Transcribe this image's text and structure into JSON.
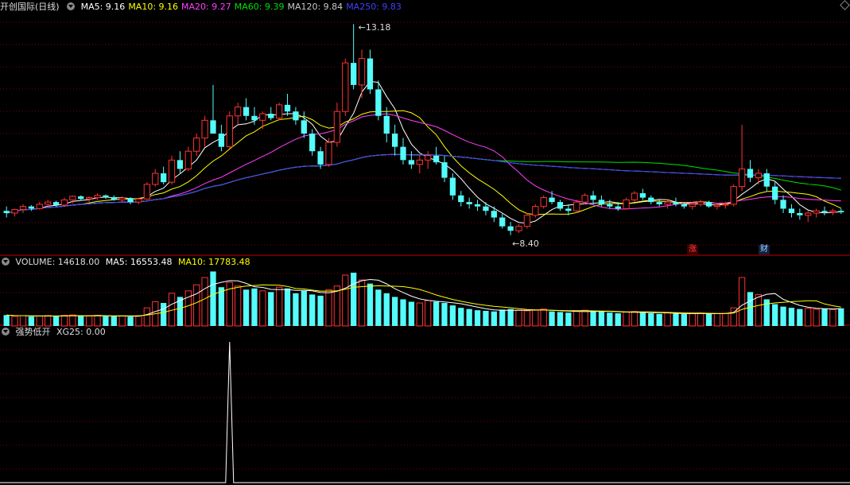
{
  "header": {
    "name": "开创国际(日线)",
    "ma": [
      {
        "label": "MA5: 9.16",
        "color": "#ffffff"
      },
      {
        "label": "MA10: 9.16",
        "color": "#ffff00"
      },
      {
        "label": "MA20: 9.27",
        "color": "#ff40ff"
      },
      {
        "label": "MA60: 9.39",
        "color": "#00e000"
      },
      {
        "label": "MA120: 9.84",
        "color": "#c8c8c8"
      },
      {
        "label": "MA250: 9.83",
        "color": "#4040ff"
      }
    ]
  },
  "volume_header": {
    "label": "VOLUME: 14618.00",
    "ma5": "MA5: 16553.48",
    "ma10": "MA10: 17783.48"
  },
  "indicator_header": {
    "name": "强势低开",
    "value": "XG25: 0.00"
  },
  "annotations": {
    "high": "13.18",
    "low": "8.40",
    "badge1": "涨",
    "badge2": "财"
  },
  "colors": {
    "up": "#ff3232",
    "down": "#54fcfc",
    "grid": "#800000",
    "axis": "#c00000"
  },
  "chart_data": {
    "type": "candlestick",
    "price_range": [
      8.0,
      13.4
    ],
    "candles": [
      [
        8.95,
        9.05,
        8.8,
        8.9
      ],
      [
        8.9,
        9.0,
        8.82,
        8.98
      ],
      [
        8.98,
        9.1,
        8.9,
        9.05
      ],
      [
        9.05,
        9.08,
        8.95,
        9.0
      ],
      [
        9.0,
        9.15,
        8.98,
        9.1
      ],
      [
        9.1,
        9.2,
        9.02,
        9.15
      ],
      [
        9.15,
        9.18,
        9.05,
        9.08
      ],
      [
        9.08,
        9.25,
        9.05,
        9.2
      ],
      [
        9.2,
        9.3,
        9.12,
        9.28
      ],
      [
        9.28,
        9.3,
        9.18,
        9.22
      ],
      [
        9.22,
        9.28,
        9.15,
        9.25
      ],
      [
        9.25,
        9.35,
        9.2,
        9.3
      ],
      [
        9.3,
        9.32,
        9.22,
        9.26
      ],
      [
        9.26,
        9.3,
        9.18,
        9.2
      ],
      [
        9.2,
        9.28,
        9.15,
        9.24
      ],
      [
        9.24,
        9.26,
        9.1,
        9.15
      ],
      [
        9.15,
        9.25,
        9.1,
        9.22
      ],
      [
        9.22,
        9.6,
        9.2,
        9.55
      ],
      [
        9.55,
        9.9,
        9.5,
        9.8
      ],
      [
        9.8,
        9.95,
        9.55,
        9.6
      ],
      [
        9.6,
        10.2,
        9.55,
        10.1
      ],
      [
        10.1,
        10.3,
        9.8,
        9.9
      ],
      [
        9.9,
        10.4,
        9.85,
        10.3
      ],
      [
        10.3,
        10.7,
        10.2,
        10.6
      ],
      [
        10.6,
        11.1,
        10.4,
        11.0
      ],
      [
        11.0,
        11.8,
        10.8,
        10.7
      ],
      [
        10.7,
        10.9,
        10.3,
        10.4
      ],
      [
        10.4,
        11.2,
        10.35,
        11.1
      ],
      [
        11.1,
        11.4,
        10.9,
        11.3
      ],
      [
        11.3,
        11.5,
        11.0,
        11.1
      ],
      [
        11.1,
        11.3,
        10.9,
        11.0
      ],
      [
        11.0,
        11.2,
        10.8,
        11.15
      ],
      [
        11.15,
        11.3,
        11.0,
        11.05
      ],
      [
        11.05,
        11.4,
        11.0,
        11.35
      ],
      [
        11.35,
        11.6,
        11.1,
        11.2
      ],
      [
        11.2,
        11.3,
        10.9,
        11.0
      ],
      [
        11.0,
        11.2,
        10.6,
        10.7
      ],
      [
        10.7,
        10.8,
        10.2,
        10.3
      ],
      [
        10.3,
        10.4,
        9.9,
        10.0
      ],
      [
        10.0,
        10.6,
        9.95,
        10.5
      ],
      [
        10.5,
        11.4,
        10.4,
        11.2
      ],
      [
        11.2,
        12.4,
        11.1,
        12.3
      ],
      [
        12.3,
        13.18,
        11.7,
        11.8
      ],
      [
        11.8,
        12.6,
        11.5,
        12.4
      ],
      [
        12.4,
        12.6,
        11.6,
        11.7
      ],
      [
        11.7,
        11.9,
        11.0,
        11.1
      ],
      [
        11.1,
        11.3,
        10.5,
        10.7
      ],
      [
        10.7,
        10.9,
        10.2,
        10.4
      ],
      [
        10.4,
        10.6,
        10.0,
        10.1
      ],
      [
        10.1,
        10.3,
        9.9,
        10.0
      ],
      [
        10.0,
        10.2,
        9.8,
        10.1
      ],
      [
        10.1,
        10.3,
        9.9,
        10.2
      ],
      [
        10.2,
        10.4,
        10.0,
        10.05
      ],
      [
        10.05,
        10.2,
        9.6,
        9.7
      ],
      [
        9.7,
        9.8,
        9.2,
        9.3
      ],
      [
        9.3,
        9.4,
        9.05,
        9.15
      ],
      [
        9.15,
        9.25,
        9.0,
        9.1
      ],
      [
        9.1,
        9.2,
        8.95,
        9.05
      ],
      [
        9.05,
        9.15,
        8.85,
        8.95
      ],
      [
        8.95,
        9.05,
        8.7,
        8.8
      ],
      [
        8.8,
        8.9,
        8.55,
        8.6
      ],
      [
        8.6,
        8.7,
        8.4,
        8.5
      ],
      [
        8.5,
        8.65,
        8.45,
        8.6
      ],
      [
        8.6,
        8.9,
        8.55,
        8.85
      ],
      [
        8.85,
        9.1,
        8.8,
        9.05
      ],
      [
        9.05,
        9.3,
        9.0,
        9.25
      ],
      [
        9.25,
        9.4,
        9.1,
        9.15
      ],
      [
        9.15,
        9.2,
        8.95,
        9.0
      ],
      [
        9.0,
        9.1,
        8.85,
        8.95
      ],
      [
        8.95,
        9.2,
        8.9,
        9.15
      ],
      [
        9.15,
        9.35,
        9.1,
        9.3
      ],
      [
        9.3,
        9.4,
        9.1,
        9.2
      ],
      [
        9.2,
        9.3,
        9.05,
        9.1
      ],
      [
        9.1,
        9.2,
        9.0,
        9.05
      ],
      [
        9.05,
        9.15,
        8.95,
        9.0
      ],
      [
        9.0,
        9.25,
        8.98,
        9.2
      ],
      [
        9.2,
        9.4,
        9.15,
        9.35
      ],
      [
        9.35,
        9.45,
        9.2,
        9.25
      ],
      [
        9.25,
        9.3,
        9.1,
        9.15
      ],
      [
        9.15,
        9.2,
        9.05,
        9.1
      ],
      [
        9.1,
        9.2,
        9.0,
        9.15
      ],
      [
        9.15,
        9.25,
        9.05,
        9.1
      ],
      [
        9.1,
        9.15,
        9.0,
        9.05
      ],
      [
        9.05,
        9.15,
        8.98,
        9.1
      ],
      [
        9.1,
        9.2,
        9.05,
        9.15
      ],
      [
        9.15,
        9.18,
        9.02,
        9.05
      ],
      [
        9.05,
        9.12,
        8.98,
        9.08
      ],
      [
        9.08,
        9.15,
        9.0,
        9.1
      ],
      [
        9.1,
        9.55,
        9.05,
        9.5
      ],
      [
        9.5,
        10.9,
        9.4,
        9.9
      ],
      [
        9.9,
        10.1,
        9.6,
        9.7
      ],
      [
        9.7,
        9.9,
        9.55,
        9.8
      ],
      [
        9.8,
        9.9,
        9.4,
        9.5
      ],
      [
        9.5,
        9.6,
        9.1,
        9.2
      ],
      [
        9.2,
        9.3,
        8.9,
        9.0
      ],
      [
        9.0,
        9.1,
        8.8,
        8.9
      ],
      [
        8.9,
        9.0,
        8.75,
        8.85
      ],
      [
        8.85,
        8.95,
        8.7,
        8.9
      ],
      [
        8.9,
        9.0,
        8.8,
        8.95
      ],
      [
        8.95,
        9.05,
        8.85,
        8.92
      ],
      [
        8.92,
        9.0,
        8.85,
        8.95
      ],
      [
        8.95,
        9.0,
        8.88,
        8.92
      ]
    ],
    "volume": [
      9000,
      8000,
      8500,
      7800,
      8200,
      8600,
      7900,
      8800,
      9100,
      8400,
      8200,
      8700,
      8100,
      7900,
      8300,
      7700,
      8500,
      15000,
      20000,
      19000,
      27000,
      24000,
      29000,
      34000,
      40000,
      45000,
      32000,
      36000,
      33000,
      30000,
      31000,
      29000,
      28000,
      32000,
      31000,
      27000,
      29000,
      26000,
      25000,
      30000,
      33000,
      42000,
      44000,
      38000,
      35000,
      30000,
      27000,
      24000,
      22000,
      20000,
      19000,
      21000,
      20000,
      19000,
      17000,
      15000,
      14000,
      13000,
      12500,
      12000,
      13500,
      14000,
      13000,
      12500,
      13000,
      14000,
      12000,
      11500,
      11000,
      12000,
      13000,
      12500,
      11800,
      11000,
      10500,
      11500,
      12000,
      11000,
      10500,
      10000,
      10800,
      10200,
      9800,
      10300,
      10600,
      9900,
      10200,
      10400,
      15000,
      40000,
      28000,
      26000,
      22000,
      18000,
      16000,
      15000,
      14000,
      14500,
      13800,
      14200,
      13600,
      14618
    ],
    "indicator": {
      "name": "XG25",
      "signal_index": 27,
      "value": 0.0
    }
  }
}
